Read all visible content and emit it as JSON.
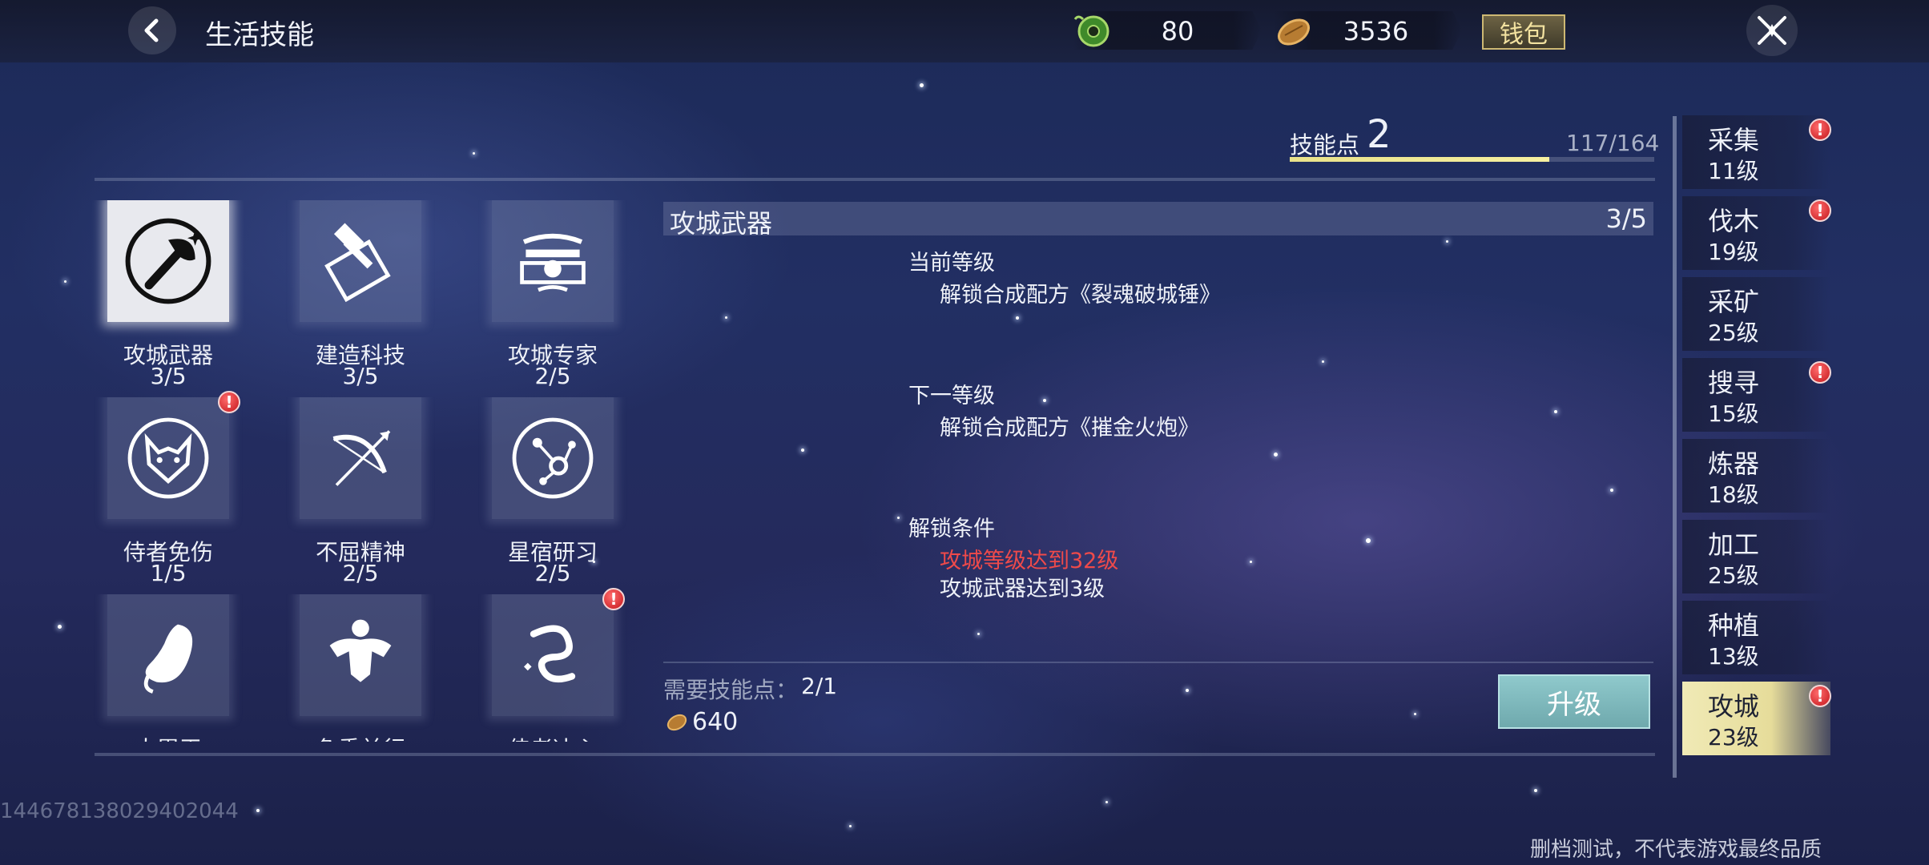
{
  "header": {
    "title": "生活技能",
    "jade_value": "80",
    "gold_value": "3536",
    "wallet_label": "钱包"
  },
  "skill_points": {
    "label": "技能点",
    "value": "2",
    "progress_text": "117/164",
    "progress_fraction": 0.713
  },
  "skills": [
    {
      "name": "攻城武器",
      "level": "3/5",
      "icon": "siege-axe-icon",
      "selected": true,
      "alert": false
    },
    {
      "name": "建造科技",
      "level": "3/5",
      "icon": "hammer-blueprint-icon",
      "selected": false,
      "alert": false
    },
    {
      "name": "攻城专家",
      "level": "2/5",
      "icon": "pavilion-icon",
      "selected": false,
      "alert": false
    },
    {
      "name": "侍者免伤",
      "level": "1/5",
      "icon": "fox-mask-icon",
      "selected": false,
      "alert": true
    },
    {
      "name": "不屈精神",
      "level": "2/5",
      "icon": "bow-arrow-icon",
      "selected": false,
      "alert": false
    },
    {
      "name": "星宿研习",
      "level": "2/5",
      "icon": "constellation-icon",
      "selected": false,
      "alert": false
    },
    {
      "name": "大胃王",
      "level": "",
      "icon": "stomach-icon",
      "selected": false,
      "alert": false
    },
    {
      "name": "负重前行",
      "level": "",
      "icon": "muscle-icon",
      "selected": false,
      "alert": false
    },
    {
      "name": "侍者决心",
      "level": "",
      "icon": "dragon-icon",
      "selected": false,
      "alert": true
    }
  ],
  "detail": {
    "title": "攻城武器",
    "level": "3/5",
    "current_label": "当前等级",
    "current_desc": "解锁合成配方《裂魂破城锤》",
    "next_label": "下一等级",
    "next_desc": "解锁合成配方《摧金火炮》",
    "unlock_label": "解锁条件",
    "unlock_cond_unmet": "攻城等级达到32级",
    "unlock_cond_met": "攻城武器达到3级",
    "cost_label": "需要技能点：",
    "cost_value": "2/1",
    "gold_cost": "640",
    "upgrade_label": "升级"
  },
  "categories": [
    {
      "name": "采集",
      "level": "11级",
      "alert": true,
      "selected": false
    },
    {
      "name": "伐木",
      "level": "19级",
      "alert": true,
      "selected": false
    },
    {
      "name": "采矿",
      "level": "25级",
      "alert": false,
      "selected": false
    },
    {
      "name": "搜寻",
      "level": "15级",
      "alert": true,
      "selected": false
    },
    {
      "name": "炼器",
      "level": "18级",
      "alert": false,
      "selected": false
    },
    {
      "name": "加工",
      "level": "25级",
      "alert": false,
      "selected": false
    },
    {
      "name": "种植",
      "level": "13级",
      "alert": false,
      "selected": false
    },
    {
      "name": "攻城",
      "level": "23级",
      "alert": true,
      "selected": true
    }
  ],
  "footer": {
    "uid": "14467813802940​2044",
    "disclaimer": "删档测试，不代表游戏最终品质"
  },
  "colors": {
    "accent_yellow": "#f6f0a0",
    "alert_red": "#c4161c",
    "unmet_condition": "#ef4a4a",
    "upgrade_button": "#7fb9bd"
  }
}
